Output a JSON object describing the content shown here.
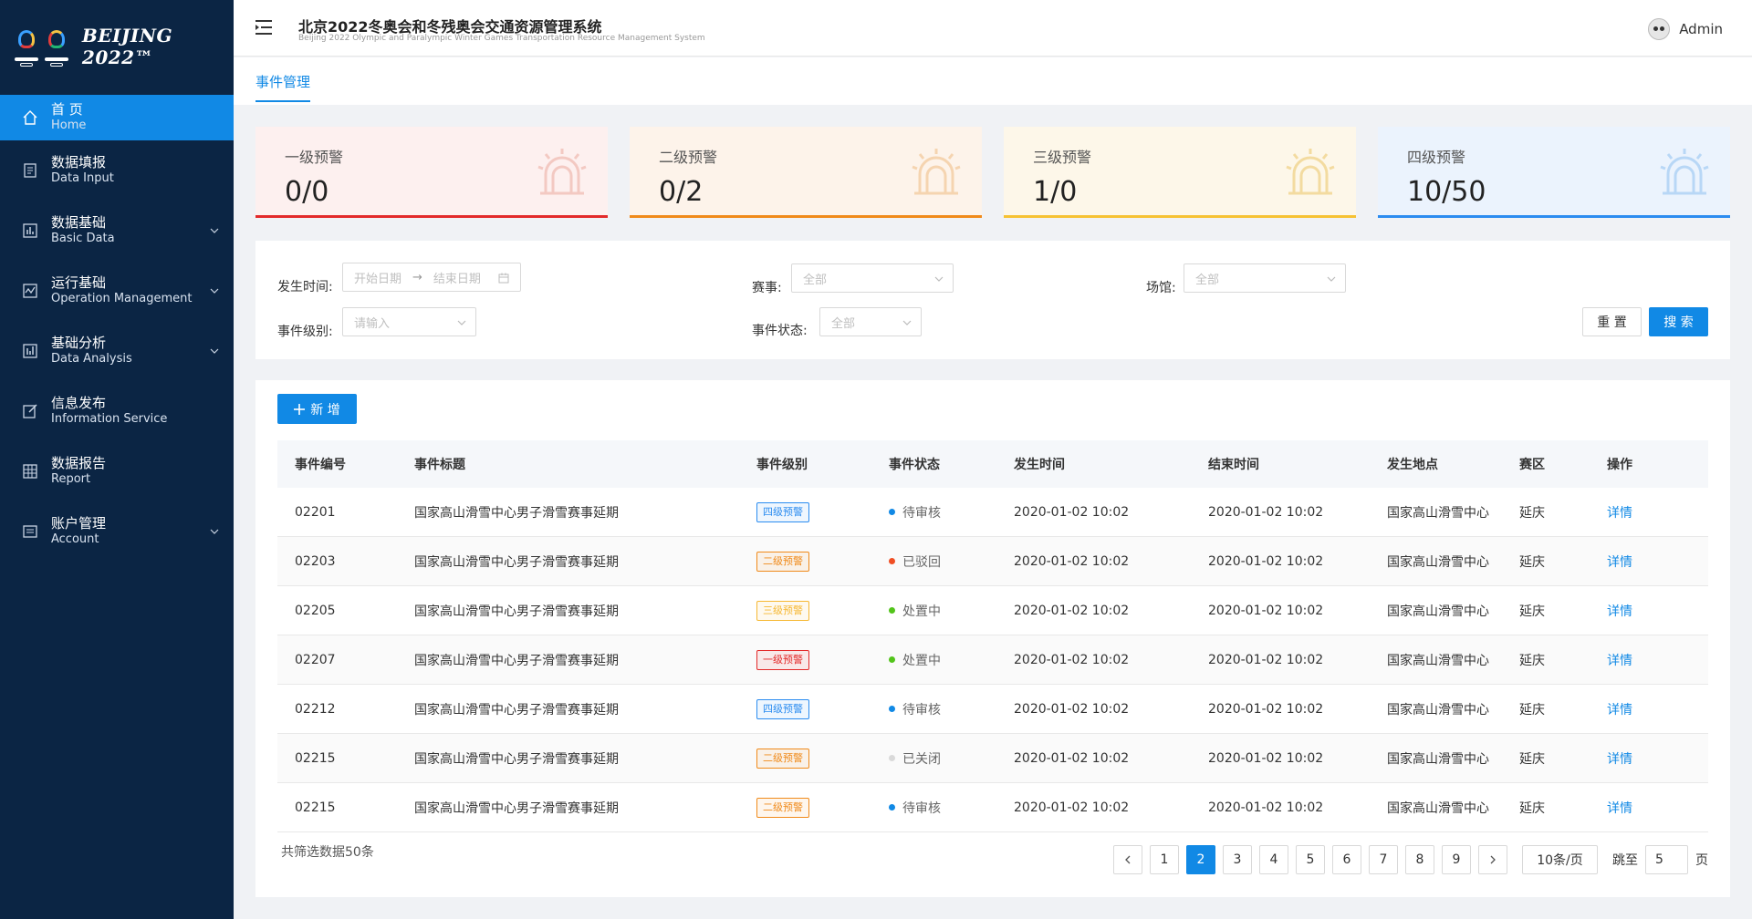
{
  "brand": {
    "logo_text": "BEIJING 2022™"
  },
  "sidebar": {
    "items": [
      {
        "cn": "首 页",
        "en": "Home",
        "icon": "home-icon",
        "active": true,
        "has_children": false
      },
      {
        "cn": "数据填报",
        "en": "Data Input",
        "icon": "form-icon",
        "active": false,
        "has_children": false
      },
      {
        "cn": "数据基础",
        "en": "Basic Data",
        "icon": "chart-bar-icon",
        "active": false,
        "has_children": true
      },
      {
        "cn": "运行基础",
        "en": "Operation Management",
        "icon": "monitor-icon",
        "active": false,
        "has_children": true
      },
      {
        "cn": "基础分析",
        "en": "Data Analysis",
        "icon": "analysis-icon",
        "active": false,
        "has_children": true
      },
      {
        "cn": "信息发布",
        "en": "Information Service",
        "icon": "edit-icon",
        "active": false,
        "has_children": false
      },
      {
        "cn": "数据报告",
        "en": "Report",
        "icon": "grid-icon",
        "active": false,
        "has_children": false
      },
      {
        "cn": "账户管理",
        "en": "Account",
        "icon": "account-icon",
        "active": false,
        "has_children": true
      }
    ]
  },
  "header": {
    "title": "北京2022冬奥会和冬残奥会交通资源管理系统",
    "subtitle": "Beijing 2022 Olympic and Paralympic Winter Games Transportation Resource Management System",
    "user": "Admin"
  },
  "tabs": [
    {
      "label": "事件管理"
    }
  ],
  "alerts": [
    {
      "title": "一级预警",
      "value": "0/0",
      "color": "#e32a2a",
      "bg": "#fdf0ef",
      "icon_color": "#f3c9c2"
    },
    {
      "title": "二级预警",
      "value": "0/2",
      "color": "#f08a1a",
      "bg": "#fdf3ea",
      "icon_color": "#f5d4b0"
    },
    {
      "title": "三级预警",
      "value": "1/0",
      "color": "#f6c233",
      "bg": "#fdf7e9",
      "icon_color": "#f3dba0"
    },
    {
      "title": "四级预警",
      "value": "10/50",
      "color": "#2b8cf0",
      "bg": "#ebf3fd",
      "icon_color": "#b8d7f6"
    }
  ],
  "filter": {
    "time_label": "发生时间:",
    "start_placeholder": "开始日期",
    "end_placeholder": "结束日期",
    "range_arrow": "→",
    "event_label": "赛事:",
    "event_value": "全部",
    "venue_label": "场馆:",
    "venue_value": "全部",
    "level_label": "事件级别:",
    "level_placeholder": "请输入",
    "status_label": "事件状态:",
    "status_value": "全部",
    "reset": "重 置",
    "search": "搜 索"
  },
  "table": {
    "add_button": "新 增",
    "columns": [
      "事件编号",
      "事件标题",
      "事件级别",
      "事件状态",
      "发生时间",
      "结束时间",
      "发生地点",
      "赛区",
      "操作"
    ],
    "rows": [
      {
        "id": "02201",
        "title": "国家高山滑雪中心男子滑雪赛事延期",
        "level": "四级预警",
        "level_color": "#2b8cf0",
        "status": "待审核",
        "status_color": "#1189e5",
        "start": "2020-01-02 10:02",
        "end": "2020-01-02 10:02",
        "place": "国家高山滑雪中心",
        "area": "延庆",
        "op": "详情"
      },
      {
        "id": "02203",
        "title": "国家高山滑雪中心男子滑雪赛事延期",
        "level": "二级预警",
        "level_color": "#f08a1a",
        "status": "已驳回",
        "status_color": "#f04e23",
        "start": "2020-01-02 10:02",
        "end": "2020-01-02 10:02",
        "place": "国家高山滑雪中心",
        "area": "延庆",
        "op": "详情"
      },
      {
        "id": "02205",
        "title": "国家高山滑雪中心男子滑雪赛事延期",
        "level": "三级预警",
        "level_color": "#f6b833",
        "status": "处置中",
        "status_color": "#52c41a",
        "start": "2020-01-02 10:02",
        "end": "2020-01-02 10:02",
        "place": "国家高山滑雪中心",
        "area": "延庆",
        "op": "详情"
      },
      {
        "id": "02207",
        "title": "国家高山滑雪中心男子滑雪赛事延期",
        "level": "一级预警",
        "level_color": "#e32a2a",
        "status": "处置中",
        "status_color": "#52c41a",
        "start": "2020-01-02 10:02",
        "end": "2020-01-02 10:02",
        "place": "国家高山滑雪中心",
        "area": "延庆",
        "op": "详情"
      },
      {
        "id": "02212",
        "title": "国家高山滑雪中心男子滑雪赛事延期",
        "level": "四级预警",
        "level_color": "#2b8cf0",
        "status": "待审核",
        "status_color": "#1189e5",
        "start": "2020-01-02 10:02",
        "end": "2020-01-02 10:02",
        "place": "国家高山滑雪中心",
        "area": "延庆",
        "op": "详情"
      },
      {
        "id": "02215",
        "title": "国家高山滑雪中心男子滑雪赛事延期",
        "level": "二级预警",
        "level_color": "#f08a1a",
        "status": "已关闭",
        "status_color": "#d9d9d9",
        "start": "2020-01-02 10:02",
        "end": "2020-01-02 10:02",
        "place": "国家高山滑雪中心",
        "area": "延庆",
        "op": "详情"
      },
      {
        "id": "02215",
        "title": "国家高山滑雪中心男子滑雪赛事延期",
        "level": "二级预警",
        "level_color": "#f08a1a",
        "status": "待审核",
        "status_color": "#1189e5",
        "start": "2020-01-02 10:02",
        "end": "2020-01-02 10:02",
        "place": "国家高山滑雪中心",
        "area": "延庆",
        "op": "详情"
      }
    ],
    "total_text": "共筛选数据50条"
  },
  "pagination": {
    "pages": [
      "1",
      "2",
      "3",
      "4",
      "5",
      "6",
      "7",
      "8",
      "9"
    ],
    "current": "2",
    "page_size": "10条/页",
    "jump_label": "跳至",
    "jump_value": "5",
    "page_suffix": "页"
  }
}
